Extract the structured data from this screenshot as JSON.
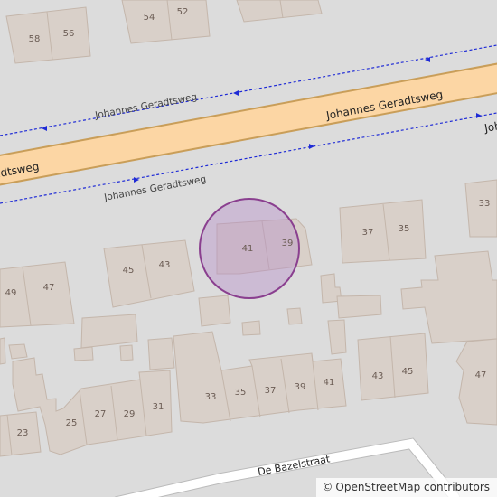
{
  "map": {
    "main_road_name": "Johannes Geradtsweg",
    "main_road_name_partial_left": "adtsweg",
    "main_road_name_partial_right": "Joh",
    "footway_north_label": "Johannes Geradtsweg",
    "footway_south_label": "Johannes Geradtsweg",
    "side_street_name": "De Bazelstraat",
    "highlight_color": "#b48cc8",
    "house_numbers": [
      "58",
      "56",
      "54",
      "52",
      "33",
      "37",
      "35",
      "41",
      "39",
      "45",
      "43",
      "49",
      "47",
      "43",
      "45",
      "47",
      "33",
      "35",
      "37",
      "39",
      "41",
      "25",
      "27",
      "29",
      "31",
      "23"
    ]
  },
  "attribution": {
    "copyright_symbol": "©",
    "text": "OpenStreetMap contributors"
  }
}
